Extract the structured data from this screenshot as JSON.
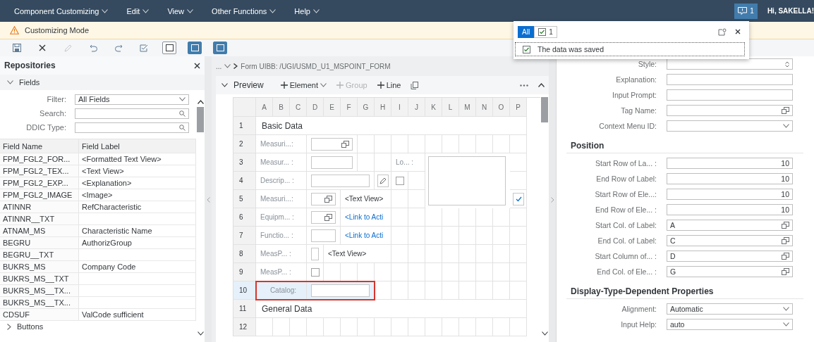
{
  "menu_bar": {
    "items": [
      {
        "label": "Component Customizing"
      },
      {
        "label": "Edit"
      },
      {
        "label": "View"
      },
      {
        "label": "Other Functions"
      },
      {
        "label": "Help"
      }
    ],
    "notifications": {
      "count": "1",
      "selected": true
    },
    "greeting": "Hi, SAKELLA!"
  },
  "mode_bar": {
    "text": "Customizing Mode"
  },
  "toolbar": [
    {
      "kind": "save",
      "disabled": false
    },
    {
      "kind": "close",
      "disabled": false
    },
    {
      "kind": "edit",
      "disabled": true
    },
    {
      "kind": "undo",
      "disabled": false
    },
    {
      "kind": "redo",
      "disabled": false
    },
    {
      "kind": "check",
      "disabled": false
    },
    {
      "kind": "layout",
      "selected": false
    },
    {
      "kind": "layout",
      "selected": true
    },
    {
      "kind": "layout",
      "selected": true
    }
  ],
  "repositories": {
    "title": "Repositories",
    "section": "Fields",
    "filters": [
      {
        "label": "Filter:",
        "value": "All Fields",
        "kind": "dropdown"
      },
      {
        "label": "Search:",
        "kind": "search"
      },
      {
        "label": "DDIC Type:",
        "kind": "search"
      }
    ],
    "columns": [
      "Field Name",
      "Field Label"
    ],
    "rows": [
      {
        "name": "FPM_FGL2_FOR...",
        "label": "<Formatted Text View>"
      },
      {
        "name": "FPM_FGL2_TEX...",
        "label": "<Text View>"
      },
      {
        "name": "FPM_FGL2_EXP...",
        "label": "<Explanation>"
      },
      {
        "name": "FPM_FGL2_IMAGE",
        "label": "<Image>"
      },
      {
        "name": "ATINNR",
        "label": "RefCharacteristic"
      },
      {
        "name": "ATINNR__TXT"
      },
      {
        "name": "ATNAM_MS",
        "label": "Characteristic Name"
      },
      {
        "name": "BEGRU",
        "label": "AuthorizGroup"
      },
      {
        "name": "BEGRU__TXT"
      },
      {
        "name": "BUKRS_MS",
        "label": "Company Code"
      },
      {
        "name": "BUKRS_MS__TXT"
      },
      {
        "name": "BUKRS_MS__TX..."
      },
      {
        "name": "BUKRS_MS__TX..."
      },
      {
        "name": "CDSUF",
        "label": "ValCode sufficient"
      }
    ],
    "next_section": "Buttons"
  },
  "breadcrumb": {
    "prefix": "...",
    "current": "Form UIBB: /UGI/USMD_U1_MSPOINT_FORM"
  },
  "preview": {
    "title": "Preview",
    "actions": [
      {
        "label": "Element",
        "menu": true,
        "disabled": false
      },
      {
        "label": "Group",
        "menu": false,
        "disabled": true
      },
      {
        "label": "Line",
        "menu": false,
        "disabled": false
      }
    ],
    "columns": [
      "A",
      "B",
      "C",
      "D",
      "E",
      "F",
      "G",
      "H",
      "I",
      "J",
      "K",
      "L",
      "M",
      "N",
      "O",
      "P"
    ],
    "rows": [
      {
        "number": "1",
        "kind": "section",
        "title": "Basic Data",
        "selected": false
      },
      {
        "number": "2",
        "kind": "form",
        "selected": false,
        "items": [
          {
            "kind": "label",
            "text": "Measuri...:"
          },
          {
            "kind": "value-help"
          }
        ]
      },
      {
        "number": "3",
        "kind": "form",
        "selected": false,
        "items": [
          {
            "kind": "label",
            "text": "Measur... :"
          },
          {
            "kind": "field"
          },
          {
            "kind": "label",
            "text": "Lo... :"
          },
          {
            "kind": "textarea"
          }
        ]
      },
      {
        "number": "4",
        "kind": "form",
        "selected": false,
        "items": [
          {
            "kind": "label",
            "text": "Descrip... :"
          },
          {
            "kind": "field"
          },
          {
            "kind": "edit-button"
          },
          {
            "kind": "checkbox",
            "checked": false
          }
        ]
      },
      {
        "number": "5",
        "kind": "form",
        "selected": false,
        "items": [
          {
            "kind": "label",
            "text": "Measuri...:"
          },
          {
            "kind": "value-help"
          },
          {
            "kind": "text",
            "text": "<Text View>"
          },
          {
            "kind": "check-button"
          }
        ]
      },
      {
        "number": "6",
        "kind": "form",
        "selected": false,
        "items": [
          {
            "kind": "label",
            "text": "Equipm... :"
          },
          {
            "kind": "value-help"
          },
          {
            "kind": "link",
            "text": "<Link to Acti"
          }
        ]
      },
      {
        "number": "7",
        "kind": "form",
        "selected": false,
        "items": [
          {
            "kind": "label",
            "text": "Functio... :"
          },
          {
            "kind": "field"
          },
          {
            "kind": "link",
            "text": "<Link to Acti"
          }
        ]
      },
      {
        "number": "8",
        "kind": "form",
        "selected": false,
        "items": [
          {
            "kind": "label",
            "text": "MeasP... :"
          },
          {
            "kind": "field"
          },
          {
            "kind": "text",
            "text": "<Text View>"
          }
        ]
      },
      {
        "number": "9",
        "kind": "form",
        "selected": false,
        "items": [
          {
            "kind": "label",
            "text": "MeasP... :"
          },
          {
            "kind": "checkbox",
            "checked": false
          }
        ]
      },
      {
        "number": "10",
        "kind": "form",
        "selected": true,
        "items": [
          {
            "kind": "label",
            "text": "Catalog:"
          },
          {
            "kind": "field"
          }
        ]
      },
      {
        "number": "11",
        "kind": "section",
        "title": "General Data",
        "selected": false
      },
      {
        "number": "12",
        "kind": "empty",
        "selected": false
      }
    ]
  },
  "properties": {
    "sections": [
      {
        "fields": [
          {
            "label": "Style:",
            "kind": "spinner"
          },
          {
            "label": "Explanation:",
            "kind": "text"
          },
          {
            "label": "Input Prompt:",
            "kind": "text"
          },
          {
            "label": "Tag Name:",
            "kind": "value-help"
          },
          {
            "label": "Context Menu ID:",
            "kind": "dropdown"
          }
        ]
      },
      {
        "title": "Position",
        "fields": [
          {
            "label": "Start Row of La... :",
            "value": "10",
            "kind": "number"
          },
          {
            "label": "End Row of Label:",
            "value": "10",
            "kind": "number"
          },
          {
            "label": "Start Row of Ele...:",
            "value": "10",
            "kind": "number"
          },
          {
            "label": "End Row of Ele... :",
            "value": "10",
            "kind": "number"
          },
          {
            "label": "Start Col. of Label:",
            "value": "A",
            "kind": "value-help"
          },
          {
            "label": "End Col. of Label:",
            "value": "C",
            "kind": "value-help"
          },
          {
            "label": "Start Column of... :",
            "value": "D",
            "kind": "value-help"
          },
          {
            "label": "End Col. of Ele... :",
            "value": "G",
            "kind": "value-help"
          }
        ]
      },
      {
        "title": "Display-Type-Dependent Properties",
        "fields": [
          {
            "label": "Alignment:",
            "value": "Automatic",
            "kind": "dropdown"
          },
          {
            "label": "Input Help:",
            "value": "auto",
            "kind": "dropdown"
          }
        ]
      }
    ]
  },
  "message_popover": {
    "filters": [
      {
        "label": "All",
        "kind": "all",
        "selected": true
      },
      {
        "label": "1",
        "kind": "success",
        "selected": false
      }
    ],
    "messages": [
      {
        "text": "The data was saved",
        "kind": "success"
      }
    ]
  }
}
